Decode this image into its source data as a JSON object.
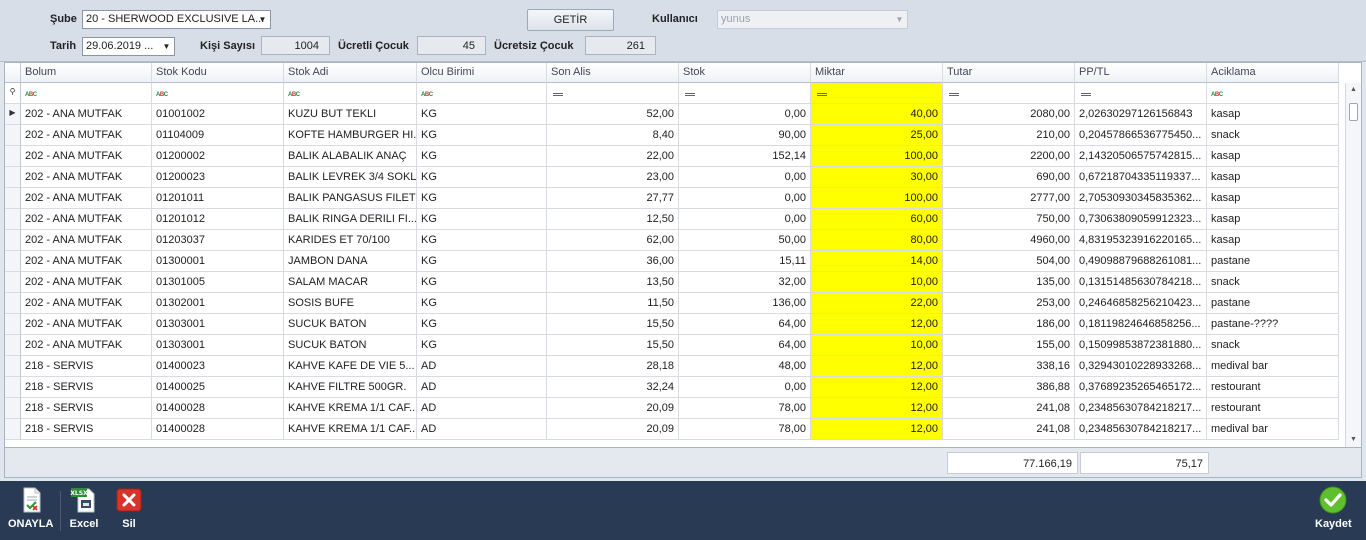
{
  "filters": {
    "sube_label": "Şube",
    "sube_value": "20 - SHERWOOD EXCLUSIVE LA...",
    "tarih_label": "Tarih",
    "tarih_value": "29.06.2019 ...",
    "kisi_label": "Kişi Sayısı",
    "kisi_value": "1004",
    "ucretli_label": "Ücretli Çocuk",
    "ucretli_value": "45",
    "ucretsiz_label": "Ücretsiz Çocuk",
    "ucretsiz_value": "261",
    "getir_label": "GETİR",
    "kullanici_label": "Kullanıcı",
    "kullanici_value": "yunus"
  },
  "grid": {
    "columns": [
      "Bolum",
      "Stok Kodu",
      "Stok Adi",
      "Olcu Birimi",
      "Son Alis",
      "Stok",
      "Miktar",
      "Tutar",
      "PP/TL",
      "Aciklama"
    ],
    "rows": [
      [
        "202 - ANA MUTFAK",
        "01001002",
        "KUZU BUT TEKLI",
        "KG",
        "52,00",
        "0,00",
        "40,00",
        "2080,00",
        "2,0263029712615684З",
        "kasap"
      ],
      [
        "202 - ANA MUTFAK",
        "01104009",
        "KOFTE HAMBURGER HI...",
        "KG",
        "8,40",
        "90,00",
        "25,00",
        "210,00",
        "0,20457866536775450...",
        "snack"
      ],
      [
        "202 - ANA MUTFAK",
        "01200002",
        "BALIK ALABALIK ANAÇ",
        "KG",
        "22,00",
        "152,14",
        "100,00",
        "2200,00",
        "2,14320506575742815...",
        "kasap"
      ],
      [
        "202 - ANA MUTFAK",
        "01200023",
        "BALIK LEVREK 3/4 SOKLU",
        "KG",
        "23,00",
        "0,00",
        "30,00",
        "690,00",
        "0,67218704335119337...",
        "kasap"
      ],
      [
        "202 - ANA MUTFAK",
        "01201011",
        "BALIK PANGASUS FILETO",
        "KG",
        "27,77",
        "0,00",
        "100,00",
        "2777,00",
        "2,70530930345835362...",
        "kasap"
      ],
      [
        "202 - ANA MUTFAK",
        "01201012",
        "BALIK RINGA DERILI FI...",
        "KG",
        "12,50",
        "0,00",
        "60,00",
        "750,00",
        "0,73063809059912323...",
        "kasap"
      ],
      [
        "202 - ANA MUTFAK",
        "01203037",
        "KARIDES ET 70/100",
        "KG",
        "62,00",
        "50,00",
        "80,00",
        "4960,00",
        "4,83195323916220165...",
        "kasap"
      ],
      [
        "202 - ANA MUTFAK",
        "01300001",
        "JAMBON DANA",
        "KG",
        "36,00",
        "15,11",
        "14,00",
        "504,00",
        "0,49098879688261081...",
        "pastane"
      ],
      [
        "202 - ANA MUTFAK",
        "01301005",
        "SALAM MACAR",
        "KG",
        "13,50",
        "32,00",
        "10,00",
        "135,00",
        "0,13151485630784218...",
        "snack"
      ],
      [
        "202 - ANA MUTFAK",
        "01302001",
        "SOSIS BUFE",
        "KG",
        "11,50",
        "136,00",
        "22,00",
        "253,00",
        "0,24646858256210423...",
        "pastane"
      ],
      [
        "202 - ANA MUTFAK",
        "01303001",
        "SUCUK BATON",
        "KG",
        "15,50",
        "64,00",
        "12,00",
        "186,00",
        "0,18119824646858256...",
        "pastane-????"
      ],
      [
        "202 - ANA MUTFAK",
        "01303001",
        "SUCUK BATON",
        "KG",
        "15,50",
        "64,00",
        "10,00",
        "155,00",
        "0,15099853872381880...",
        "snack"
      ],
      [
        "218 - SERVIS",
        "01400023",
        "KAHVE  KAFE DE VIE 5...",
        "AD",
        "28,18",
        "48,00",
        "12,00",
        "338,16",
        "0,32943010228933268...",
        "medival bar"
      ],
      [
        "218 - SERVIS",
        "01400025",
        "KAHVE FILTRE 500GR.",
        "AD",
        "32,24",
        "0,00",
        "12,00",
        "386,88",
        "0,37689235265465172...",
        "restourant"
      ],
      [
        "218 - SERVIS",
        "01400028",
        "KAHVE KREMA 1/1 CAF...",
        "AD",
        "20,09",
        "78,00",
        "12,00",
        "241,08",
        "0,23485630784218217...",
        "restourant"
      ],
      [
        "218 - SERVIS",
        "01400028",
        "KAHVE KREMA 1/1 CAF...",
        "AD",
        "20,09",
        "78,00",
        "12,00",
        "241,08",
        "0,23485630784218217...",
        "medival bar"
      ]
    ],
    "highlight_color": "#ffff00"
  },
  "totals": {
    "tutar": "77.166,19",
    "pptl": "75,17"
  },
  "toolbar": {
    "onayla": "ONAYLA",
    "excel": "Excel",
    "sil": "Sil",
    "kaydet": "Kaydet",
    "excel_badge": "XLSX"
  },
  "icons": {
    "onayla": "document-approve-icon",
    "excel": "excel-export-icon",
    "sil": "delete-icon",
    "kaydet": "checkmark-save-icon"
  }
}
